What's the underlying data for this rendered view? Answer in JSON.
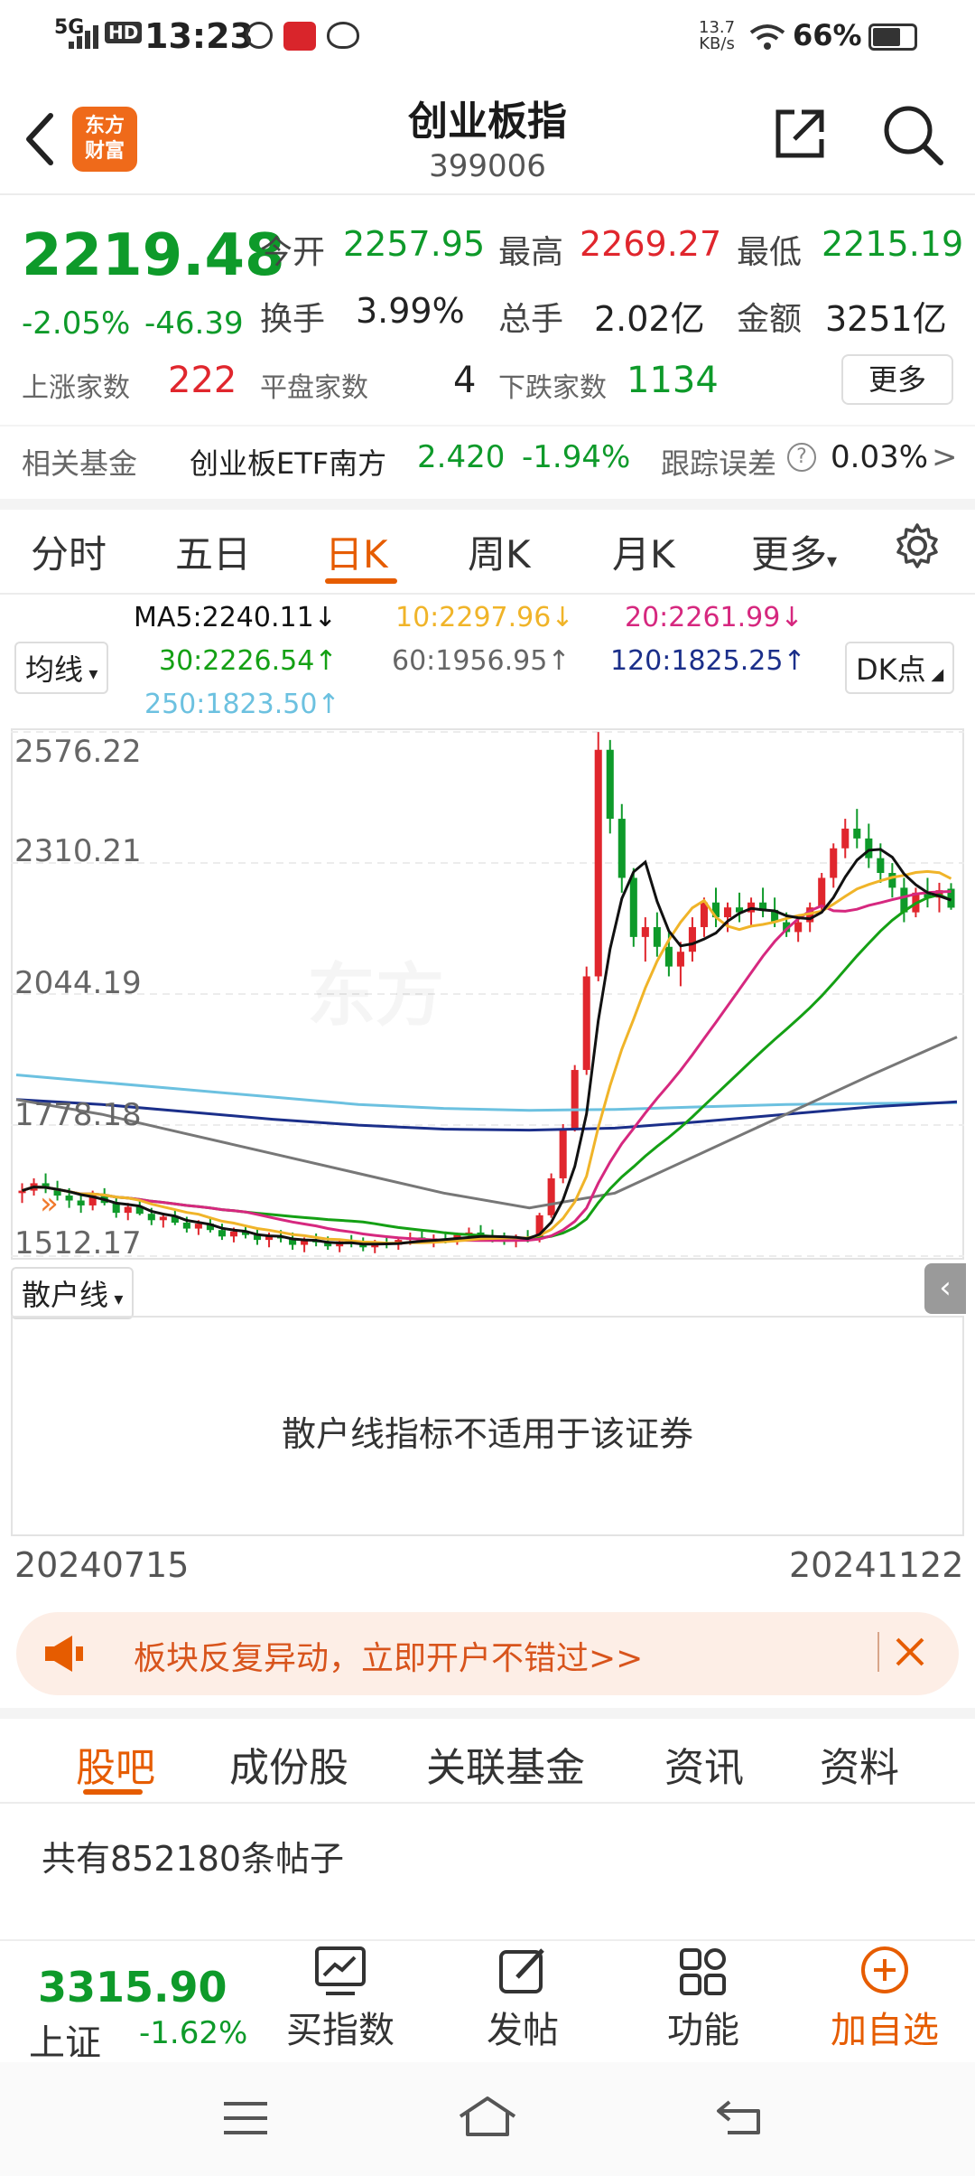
{
  "status_bar": {
    "network": "5G",
    "hd": "HD",
    "time": "13:23",
    "speed_top": "13.7",
    "speed_bottom": "KB/s",
    "battery": "66%"
  },
  "header": {
    "logo_line1": "东方",
    "logo_line2": "财富",
    "title": "创业板指",
    "code": "399006"
  },
  "quote": {
    "price": "2219.48",
    "change_pct": "-2.05%",
    "change_abs": "-46.39",
    "open_label": "今开",
    "open": "2257.95",
    "high_label": "最高",
    "high": "2269.27",
    "low_label": "最低",
    "low": "2215.19",
    "turnover_label": "换手",
    "turnover": "3.99%",
    "volume_label": "总手",
    "volume": "2.02亿",
    "amount_label": "金额",
    "amount": "3251亿",
    "up_label": "上涨家数",
    "up": "222",
    "flat_label": "平盘家数",
    "flat": "4",
    "down_label": "下跌家数",
    "down": "1134",
    "more_button": "更多"
  },
  "fund": {
    "label": "相关基金",
    "name": "创业板ETF南方",
    "price": "2.420",
    "change": "-1.94%",
    "tracking_label": "跟踪误差",
    "tracking": "0.03%",
    "arrow": ">"
  },
  "period_tabs": [
    "分时",
    "五日",
    "日K",
    "周K",
    "月K",
    "更多"
  ],
  "ma_legend": {
    "selector": "均线",
    "ma5": "MA5:2240.11↓",
    "ma10": "10:2297.96↓",
    "ma20": "20:2261.99↓",
    "ma30": "30:2226.54↑",
    "ma60": "60:1956.95↑",
    "ma120": "120:1825.25↑",
    "ma250": "250:1823.50↑",
    "dk_button": "DK点"
  },
  "colors": {
    "up": "#e0262d",
    "down": "#0e9a2a",
    "accent": "#e65c00",
    "ma5": "#111111",
    "ma10": "#f0b429",
    "ma20": "#d6287f",
    "ma30": "#14a014",
    "ma60": "#777777",
    "ma120": "#1b2f8a",
    "ma250": "#6cc1e0"
  },
  "chart_data": {
    "type": "candlestick",
    "y_ticks": [
      "2576.22",
      "2310.21",
      "2044.19",
      "1778.18",
      "1512.17"
    ],
    "ylim": [
      1512.17,
      2576.22
    ],
    "x_start": "20240715",
    "x_end": "20241122",
    "candles": [
      [
        1640,
        1660,
        1620,
        1645
      ],
      [
        1645,
        1670,
        1635,
        1660
      ],
      [
        1660,
        1680,
        1640,
        1650
      ],
      [
        1650,
        1665,
        1625,
        1635
      ],
      [
        1635,
        1650,
        1610,
        1625
      ],
      [
        1625,
        1640,
        1600,
        1615
      ],
      [
        1615,
        1645,
        1605,
        1638
      ],
      [
        1638,
        1650,
        1615,
        1620
      ],
      [
        1620,
        1630,
        1590,
        1600
      ],
      [
        1600,
        1620,
        1585,
        1612
      ],
      [
        1612,
        1625,
        1595,
        1598
      ],
      [
        1598,
        1610,
        1575,
        1585
      ],
      [
        1585,
        1600,
        1570,
        1592
      ],
      [
        1592,
        1605,
        1575,
        1580
      ],
      [
        1580,
        1592,
        1560,
        1568
      ],
      [
        1568,
        1585,
        1555,
        1578
      ],
      [
        1578,
        1590,
        1560,
        1565
      ],
      [
        1565,
        1578,
        1545,
        1552
      ],
      [
        1552,
        1570,
        1540,
        1562
      ],
      [
        1562,
        1575,
        1548,
        1555
      ],
      [
        1555,
        1566,
        1535,
        1545
      ],
      [
        1545,
        1560,
        1530,
        1552
      ],
      [
        1552,
        1565,
        1540,
        1548
      ],
      [
        1548,
        1560,
        1525,
        1535
      ],
      [
        1535,
        1550,
        1520,
        1545
      ],
      [
        1545,
        1558,
        1532,
        1540
      ],
      [
        1540,
        1552,
        1525,
        1532
      ],
      [
        1532,
        1548,
        1520,
        1542
      ],
      [
        1542,
        1555,
        1530,
        1538
      ],
      [
        1538,
        1550,
        1522,
        1530
      ],
      [
        1530,
        1545,
        1518,
        1540
      ],
      [
        1540,
        1552,
        1528,
        1535
      ],
      [
        1535,
        1548,
        1525,
        1545
      ],
      [
        1545,
        1560,
        1535,
        1550
      ],
      [
        1550,
        1562,
        1538,
        1542
      ],
      [
        1542,
        1556,
        1530,
        1548
      ],
      [
        1548,
        1562,
        1538,
        1545
      ],
      [
        1545,
        1560,
        1535,
        1555
      ],
      [
        1555,
        1570,
        1545,
        1560
      ],
      [
        1560,
        1575,
        1548,
        1552
      ],
      [
        1552,
        1566,
        1540,
        1548
      ],
      [
        1548,
        1560,
        1535,
        1542
      ],
      [
        1542,
        1556,
        1530,
        1550
      ],
      [
        1550,
        1565,
        1540,
        1546
      ],
      [
        1546,
        1600,
        1540,
        1595
      ],
      [
        1595,
        1680,
        1590,
        1670
      ],
      [
        1670,
        1780,
        1660,
        1770
      ],
      [
        1770,
        1900,
        1765,
        1890
      ],
      [
        1890,
        2100,
        1880,
        2080
      ],
      [
        2080,
        2576,
        2070,
        2540
      ],
      [
        2540,
        2560,
        2370,
        2400
      ],
      [
        2400,
        2430,
        2250,
        2280
      ],
      [
        2280,
        2300,
        2140,
        2160
      ],
      [
        2160,
        2200,
        2110,
        2180
      ],
      [
        2180,
        2210,
        2120,
        2140
      ],
      [
        2140,
        2170,
        2080,
        2100
      ],
      [
        2100,
        2150,
        2060,
        2130
      ],
      [
        2130,
        2200,
        2110,
        2180
      ],
      [
        2180,
        2240,
        2160,
        2230
      ],
      [
        2230,
        2260,
        2180,
        2200
      ],
      [
        2200,
        2230,
        2170,
        2220
      ],
      [
        2220,
        2250,
        2190,
        2210
      ],
      [
        2210,
        2240,
        2180,
        2230
      ],
      [
        2230,
        2260,
        2200,
        2215
      ],
      [
        2215,
        2240,
        2180,
        2190
      ],
      [
        2190,
        2210,
        2160,
        2170
      ],
      [
        2170,
        2200,
        2150,
        2190
      ],
      [
        2190,
        2230,
        2170,
        2220
      ],
      [
        2220,
        2290,
        2210,
        2280
      ],
      [
        2280,
        2350,
        2260,
        2340
      ],
      [
        2340,
        2400,
        2320,
        2380
      ],
      [
        2380,
        2420,
        2340,
        2360
      ],
      [
        2360,
        2390,
        2300,
        2320
      ],
      [
        2320,
        2350,
        2270,
        2290
      ],
      [
        2290,
        2310,
        2240,
        2260
      ],
      [
        2260,
        2280,
        2190,
        2210
      ],
      [
        2210,
        2260,
        2200,
        2250
      ],
      [
        2250,
        2280,
        2220,
        2240
      ],
      [
        2240,
        2270,
        2210,
        2255
      ],
      [
        2257.95,
        2269.27,
        2215.19,
        2219.48
      ]
    ],
    "ma_lines": {
      "ma250": [
        1880,
        1865,
        1850,
        1835,
        1820,
        1812,
        1808,
        1810,
        1815,
        1820,
        1822,
        1823.5
      ],
      "ma120": [
        1830,
        1820,
        1805,
        1790,
        1778,
        1770,
        1768,
        1772,
        1785,
        1800,
        1815,
        1825.25
      ],
      "ma60": [
        1830,
        1800,
        1760,
        1720,
        1680,
        1640,
        1610,
        1640,
        1720,
        1800,
        1880,
        1956.95
      ]
    }
  },
  "sub_indicator": {
    "selector": "散户线",
    "message": "散户线指标不适用于该证券"
  },
  "banner": {
    "text": "板块反复异动，立即开户不错过>>"
  },
  "bottom_tabs": [
    "股吧",
    "成份股",
    "关联基金",
    "资讯",
    "资料"
  ],
  "posts_count": "共有852180条帖子",
  "bottom_bar": {
    "index_price": "3315.90",
    "index_name": "上证",
    "index_change": "-1.62%",
    "buy_index": "买指数",
    "post": "发帖",
    "functions": "功能",
    "add_watchlist": "加自选"
  }
}
